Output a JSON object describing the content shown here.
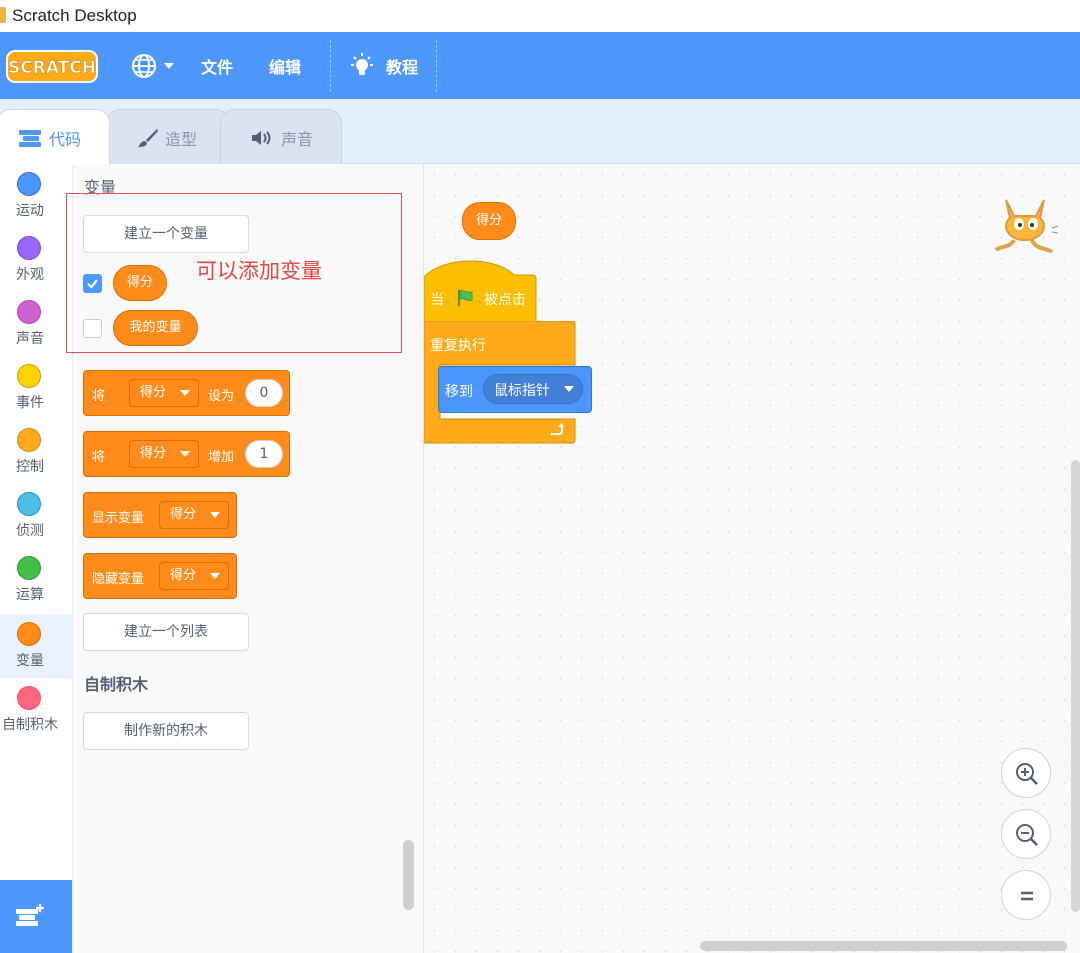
{
  "window": {
    "title": "Scratch Desktop"
  },
  "menubar": {
    "logo_text": "SCRATCH",
    "language_icon": "globe-icon",
    "file_label": "文件",
    "edit_label": "编辑",
    "tutorials_label": "教程",
    "colors": {
      "bar": "#4d97ff"
    }
  },
  "tabs": [
    {
      "label": "代码",
      "icon": "code-icon",
      "active": true
    },
    {
      "label": "造型",
      "icon": "brush-icon",
      "active": false
    },
    {
      "label": "声音",
      "icon": "speaker-icon",
      "active": false
    }
  ],
  "categories": [
    {
      "label": "运动",
      "color": "#4c97ff"
    },
    {
      "label": "外观",
      "color": "#9966ff"
    },
    {
      "label": "声音",
      "color": "#cf63cf"
    },
    {
      "label": "事件",
      "color": "#ffd500"
    },
    {
      "label": "控制",
      "color": "#ffab19"
    },
    {
      "label": "侦测",
      "color": "#4cbfe6"
    },
    {
      "label": "运算",
      "color": "#40bf4a"
    },
    {
      "label": "变量",
      "color": "#ff8c1a",
      "selected": true
    },
    {
      "label": "自制积木",
      "color": "#ff6680"
    }
  ],
  "palette": {
    "variables_heading": "变量",
    "make_variable_button": "建立一个变量",
    "annotation": "可以添加变量",
    "variables": [
      {
        "name": "得分",
        "checked": true
      },
      {
        "name": "我的变量",
        "checked": false
      }
    ],
    "blocks": {
      "set": {
        "prefix": "将",
        "variable": "得分",
        "action": "设为",
        "value": "0"
      },
      "change": {
        "prefix": "将",
        "variable": "得分",
        "action": "增加",
        "value": "1"
      },
      "show": {
        "label": "显示变量",
        "variable": "得分"
      },
      "hide": {
        "label": "隐藏变量",
        "variable": "得分"
      }
    },
    "make_list_button": "建立一个列表",
    "my_blocks_heading": "自制积木",
    "make_block_button": "制作新的积木"
  },
  "workspace": {
    "reporter": "得分",
    "hat_prefix": "当",
    "hat_suffix": "被点击",
    "forever_label": "重复执行",
    "goto_label": "移到",
    "goto_target": "鼠标指针"
  }
}
